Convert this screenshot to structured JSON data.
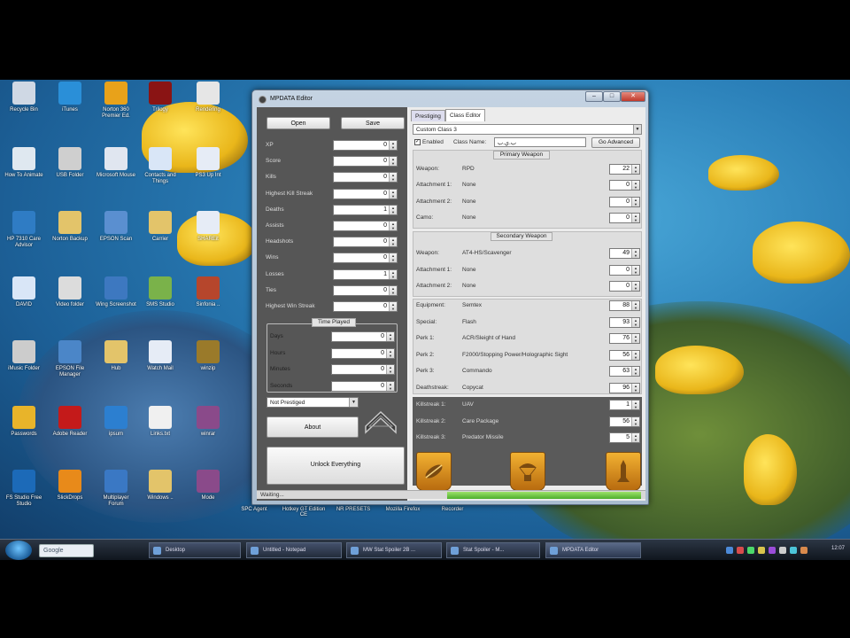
{
  "desktop": {
    "icons": [
      {
        "label": "Recycle Bin",
        "icon": "recycle-bin-icon",
        "color": "#cfd8e4"
      },
      {
        "label": "iTunes",
        "icon": "itunes-icon",
        "color": "#2a8fd8"
      },
      {
        "label": "Norton 360 Premier Ed.",
        "icon": "norton-icon",
        "color": "#e8a21a"
      },
      {
        "label": "Trilogy",
        "icon": "trilogy-icon",
        "color": "#8a1414"
      },
      {
        "label": "Rendering",
        "icon": "file-icon",
        "color": "#e6e6e6"
      },
      {
        "label": "How To Animate",
        "icon": "video-file-icon",
        "color": "#dfe8f0"
      },
      {
        "label": "USB Folder",
        "icon": "usb-icon",
        "color": "#cfcfcf"
      },
      {
        "label": "Microsoft Mouse",
        "icon": "mouse-icon",
        "color": "#e0e6f0"
      },
      {
        "label": "Contacts and Things",
        "icon": "word-doc-icon",
        "color": "#d9e6f7"
      },
      {
        "label": "PS3 Up Int",
        "icon": "package-icon",
        "color": "#e6ecf6"
      },
      {
        "label": "HP 7310 Care Advisor",
        "icon": "hp-icon",
        "color": "#2f7cc4"
      },
      {
        "label": "Norton Backup",
        "icon": "folder-icon",
        "color": "#e3c46a"
      },
      {
        "label": "EPSON Scan",
        "icon": "scanner-icon",
        "color": "#5a8fd0"
      },
      {
        "label": "Carrier",
        "icon": "folder-icon",
        "color": "#e3c46a"
      },
      {
        "label": "SHAREit",
        "icon": "package-icon",
        "color": "#e6ecf6"
      },
      {
        "label": "DAVID",
        "icon": "word-doc-icon",
        "color": "#d9e6f7"
      },
      {
        "label": "Video folder",
        "icon": "camera-icon",
        "color": "#dcdcdc"
      },
      {
        "label": "Wing Screenshot",
        "icon": "screenshot-icon",
        "color": "#3d78c0"
      },
      {
        "label": "SMS Studio",
        "icon": "studio-icon",
        "color": "#7ab24a"
      },
      {
        "label": "Sinfonia ..",
        "icon": "game-icon",
        "color": "#b6462c"
      },
      {
        "label": "iMusic Folder",
        "icon": "speaker-icon",
        "color": "#cccccc"
      },
      {
        "label": "EPSON File Manager",
        "icon": "epson-icon",
        "color": "#4b86c8"
      },
      {
        "label": "Hub",
        "icon": "folder-icon",
        "color": "#e3c46a"
      },
      {
        "label": "Watch Mail",
        "icon": "mail-icon",
        "color": "#e6ecf6"
      },
      {
        "label": "winzip",
        "icon": "winzip-icon",
        "color": "#9a7a2a"
      },
      {
        "label": "Passwords",
        "icon": "lock-icon",
        "color": "#e8b42a"
      },
      {
        "label": "Adobe Reader",
        "icon": "pdf-icon",
        "color": "#c41a1a"
      },
      {
        "label": "ipsum",
        "icon": "lightning-icon",
        "color": "#2c7fd0"
      },
      {
        "label": "Links.txt",
        "icon": "text-file-icon",
        "color": "#f0f0f0"
      },
      {
        "label": "winrar",
        "icon": "winrar-icon",
        "color": "#8a4a8a"
      },
      {
        "label": "FS Studio Free Studio",
        "icon": "fs-icon",
        "color": "#1c6ab8"
      },
      {
        "label": "SlickDrops",
        "icon": "drop-icon",
        "color": "#e88a1a"
      },
      {
        "label": "Multiplayer Forum",
        "icon": "network-icon",
        "color": "#3a78c4"
      },
      {
        "label": "Windows ..",
        "icon": "folder-icon",
        "color": "#e3c46a"
      },
      {
        "label": "Mode",
        "icon": "winrar-icon",
        "color": "#8a4a8a"
      }
    ],
    "bottom_labels": [
      "SPC Agent",
      "Hotkey GT Edition CE",
      "NR PRESETS",
      "Mozilla Firefox",
      "Recorder"
    ]
  },
  "taskbar": {
    "search_text": "Google",
    "items": [
      {
        "label": "Desktop"
      },
      {
        "label": "Untitled - Notepad"
      },
      {
        "label": "MW Stat Spoiler 2B ..."
      },
      {
        "label": "Stat Spoiler - M..."
      },
      {
        "label": "MPDATA Editor"
      }
    ],
    "clock": "12:07"
  },
  "window": {
    "title": "MPDATA Editor",
    "min_label": "–",
    "max_label": "□",
    "close_label": "✕",
    "open_label": "Open",
    "save_label": "Save",
    "stats": [
      {
        "label": "XP",
        "value": "0"
      },
      {
        "label": "Score",
        "value": "0"
      },
      {
        "label": "Kills",
        "value": "0"
      },
      {
        "label": "Highest Kill Streak",
        "value": "0"
      },
      {
        "label": "Deaths",
        "value": "1"
      },
      {
        "label": "Assists",
        "value": "0"
      },
      {
        "label": "Headshots",
        "value": "0"
      },
      {
        "label": "Wins",
        "value": "0"
      },
      {
        "label": "Losses",
        "value": "1"
      },
      {
        "label": "Ties",
        "value": "0"
      },
      {
        "label": "Highest Win Streak",
        "value": "0"
      }
    ],
    "time_played_title": "Time Played",
    "time": [
      {
        "label": "Days",
        "value": "0"
      },
      {
        "label": "Hours",
        "value": "0"
      },
      {
        "label": "Minutes",
        "value": "0"
      },
      {
        "label": "Seconds",
        "value": "0"
      }
    ],
    "prestige_value": "Not Prestiged",
    "about_label": "About",
    "unlock_label": "Unlock Everything",
    "tabs": [
      "Prestiging",
      "Class Editor"
    ],
    "class_select": "Custom Class 3",
    "enabled_label": "Enabled",
    "class_name_label": "Class Name:",
    "class_name_value": "ب.ي.ب",
    "advanced_label": "Go Advanced",
    "primary_title": "Primary Weapon",
    "primary": [
      {
        "label": "Weapon:",
        "value": "RPD",
        "num": "22"
      },
      {
        "label": "Attachment 1:",
        "value": "None",
        "num": "0"
      },
      {
        "label": "Attachment 2:",
        "value": "None",
        "num": "0"
      },
      {
        "label": "Camo:",
        "value": "None",
        "num": "0"
      }
    ],
    "secondary_title": "Secondary Weapon",
    "secondary": [
      {
        "label": "Weapon:",
        "value": "AT4-HS/Scavenger",
        "num": "49"
      },
      {
        "label": "Attachment 1:",
        "value": "None",
        "num": "0"
      },
      {
        "label": "Attachment 2:",
        "value": "None",
        "num": "0"
      }
    ],
    "perks": [
      {
        "label": "Equipment:",
        "value": "Semtex",
        "num": "88"
      },
      {
        "label": "Special:",
        "value": "Flash",
        "num": "93"
      },
      {
        "label": "Perk 1:",
        "value": "ACR/Sleight of Hand",
        "num": "76"
      },
      {
        "label": "Perk 2:",
        "value": "F2000/Stopping Power/Holographic Sight",
        "num": "56"
      },
      {
        "label": "Perk 3:",
        "value": "Commando",
        "num": "63"
      },
      {
        "label": "Deathstreak:",
        "value": "Copycat",
        "num": "96"
      }
    ],
    "killstreaks": [
      {
        "label": "Killstreak 1:",
        "value": "UAV",
        "num": "1"
      },
      {
        "label": "Killstreak 2:",
        "value": "Care Package",
        "num": "56"
      },
      {
        "label": "Killstreak 3:",
        "value": "Predator Missile",
        "num": "5"
      }
    ],
    "status": "Waiting...",
    "progress": 0.5
  }
}
